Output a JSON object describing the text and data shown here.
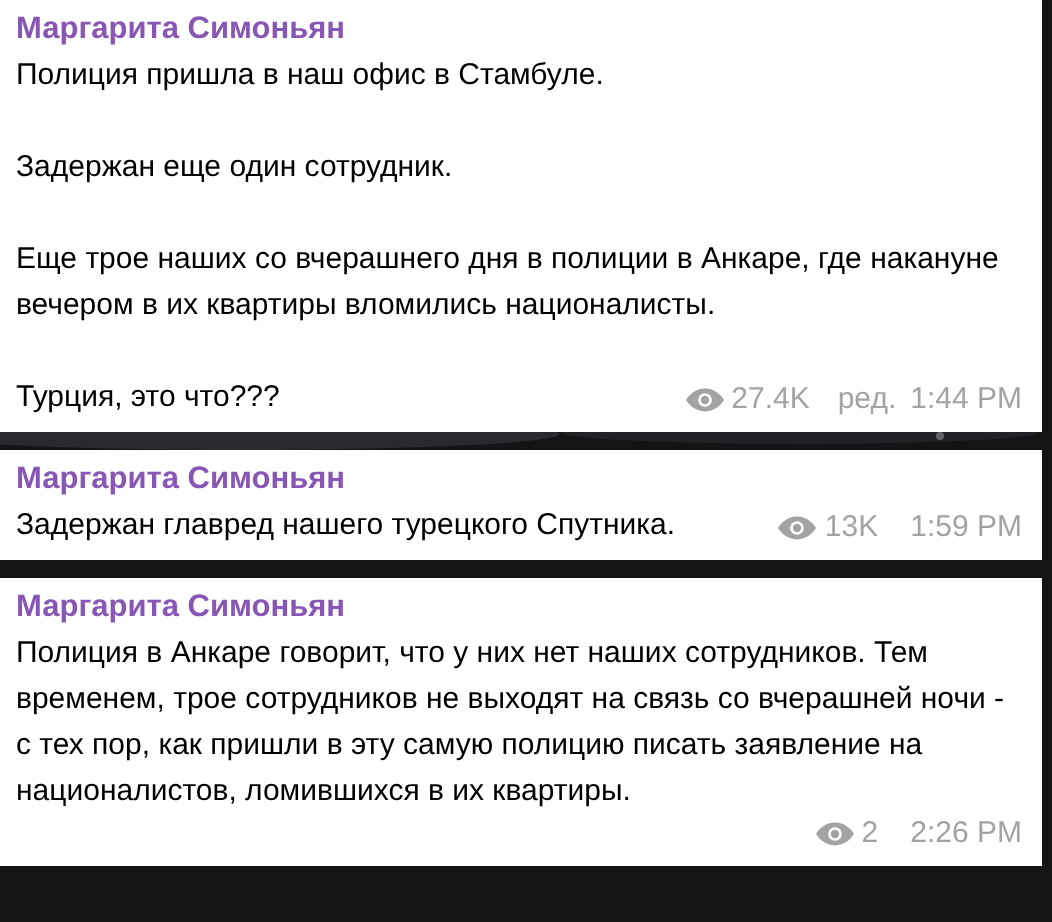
{
  "messages": [
    {
      "author": "Маргарита Симоньян",
      "paragraphs": [
        "Полиция пришла в наш офис в Стамбуле.",
        "Задержан еще один сотрудник.",
        "Еще трое наших со вчерашнего дня в полиции в Анкаре, где накануне вечером в их квартиры вломились националисты.",
        "Турция, это что???"
      ],
      "views": "27.4K",
      "edited": "ред.",
      "time": "1:44 PM"
    },
    {
      "author": "Маргарита Симоньян",
      "paragraphs": [
        "Задержан главред нашего турецкого Спутника."
      ],
      "views": "13K",
      "time": "1:59 PM"
    },
    {
      "author": "Маргарита Симоньян",
      "paragraphs": [
        "Полиция в Анкаре говорит, что у них нет наших сотрудников. Тем временем, трое сотрудников не выходят на связь со вчерашней ночи - с тех пор, как пришли в эту самую полицию писать заявление на националистов, ломившихся в их квартиры."
      ],
      "views": "2",
      "time": "2:26 PM"
    }
  ]
}
